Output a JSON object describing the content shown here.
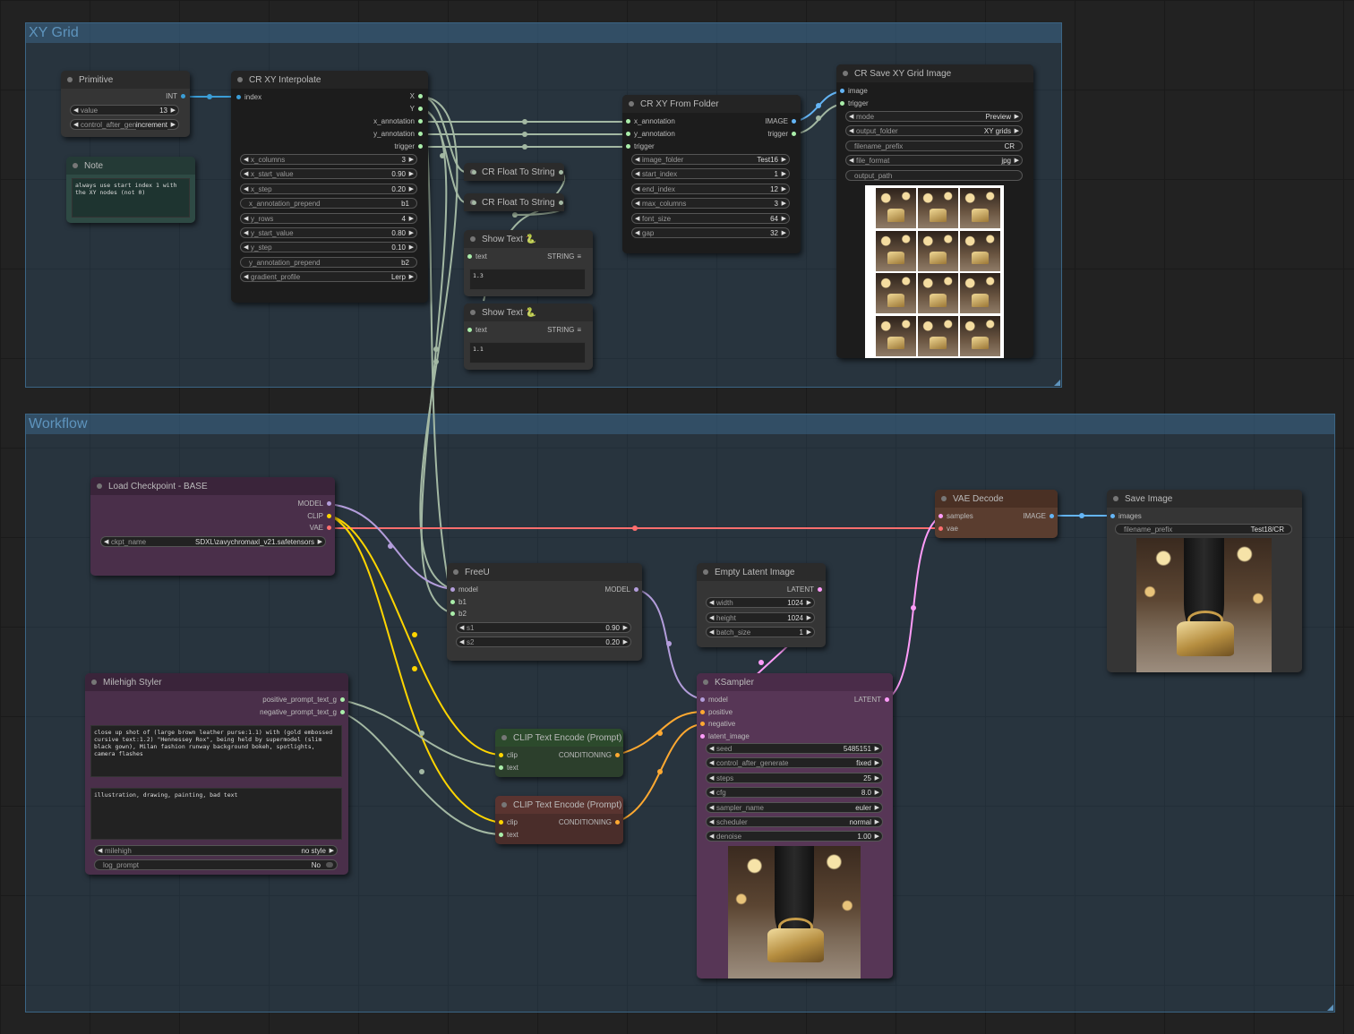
{
  "groups": {
    "xy_grid": "XY Grid",
    "workflow": "Workflow"
  },
  "primitive": {
    "title": "Primitive",
    "output": "INT",
    "value_label": "value",
    "value": "13",
    "control_label": "control_after_generate",
    "control": "increment"
  },
  "note": {
    "title": "Note",
    "text": "always use start index 1 with the XY nodes (not 0)"
  },
  "interp": {
    "title": "CR XY Interpolate",
    "input": "index",
    "outputs": [
      "X",
      "Y",
      "x_annotation",
      "y_annotation",
      "trigger"
    ],
    "widgets": [
      {
        "label": "x_columns",
        "value": "3",
        "arrows": true
      },
      {
        "label": "x_start_value",
        "value": "0.90",
        "arrows": true
      },
      {
        "label": "x_step",
        "value": "0.20",
        "arrows": true
      },
      {
        "label": "x_annotation_prepend",
        "value": "b1",
        "arrows": false
      },
      {
        "label": "y_rows",
        "value": "4",
        "arrows": true
      },
      {
        "label": "y_start_value",
        "value": "0.80",
        "arrows": true
      },
      {
        "label": "y_step",
        "value": "0.10",
        "arrows": true
      },
      {
        "label": "y_annotation_prepend",
        "value": "b2",
        "arrows": false
      },
      {
        "label": "gradient_profile",
        "value": "Lerp",
        "arrows": true
      }
    ]
  },
  "float1": {
    "title": "CR Float To String"
  },
  "float2": {
    "title": "CR Float To String"
  },
  "show1": {
    "title": "Show Text 🐍",
    "input": "text",
    "output": "STRING",
    "value": "1.3"
  },
  "show2": {
    "title": "Show Text 🐍",
    "input": "text",
    "output": "STRING",
    "value": "1.1"
  },
  "folder": {
    "title": "CR XY From Folder",
    "inputs": [
      "x_annotation",
      "y_annotation",
      "trigger"
    ],
    "outputs": [
      "IMAGE",
      "trigger"
    ],
    "widgets": [
      {
        "label": "image_folder",
        "value": "Test16"
      },
      {
        "label": "start_index",
        "value": "1"
      },
      {
        "label": "end_index",
        "value": "12"
      },
      {
        "label": "max_columns",
        "value": "3"
      },
      {
        "label": "font_size",
        "value": "64"
      },
      {
        "label": "gap",
        "value": "32"
      }
    ]
  },
  "savexy": {
    "title": "CR Save XY Grid Image",
    "inputs": [
      "image",
      "trigger"
    ],
    "widgets": [
      {
        "label": "mode",
        "value": "Preview",
        "arrows": true
      },
      {
        "label": "output_folder",
        "value": "XY grids",
        "arrows": true
      },
      {
        "label": "filename_prefix",
        "value": "CR",
        "arrows": false
      },
      {
        "label": "file_format",
        "value": "jpg",
        "arrows": true
      },
      {
        "label": "output_path",
        "value": "",
        "arrows": false
      }
    ]
  },
  "ckpt": {
    "title": "Load Checkpoint - BASE",
    "outputs": [
      "MODEL",
      "CLIP",
      "VAE"
    ],
    "widget_label": "ckpt_name",
    "widget_value": "SDXL\\zavychromaxl_v21.safetensors"
  },
  "freeu": {
    "title": "FreeU",
    "inputs": [
      "model",
      "b1",
      "b2"
    ],
    "output": "MODEL",
    "widgets": [
      {
        "label": "s1",
        "value": "0.90"
      },
      {
        "label": "s2",
        "value": "0.20"
      }
    ]
  },
  "latent": {
    "title": "Empty Latent Image",
    "output": "LATENT",
    "widgets": [
      {
        "label": "width",
        "value": "1024"
      },
      {
        "label": "height",
        "value": "1024"
      },
      {
        "label": "batch_size",
        "value": "1"
      }
    ]
  },
  "vae": {
    "title": "VAE Decode",
    "inputs": [
      "samples",
      "vae"
    ],
    "output": "IMAGE"
  },
  "save": {
    "title": "Save Image",
    "input": "images",
    "widget_label": "filename_prefix",
    "widget_value": "Test18/CR"
  },
  "styler": {
    "title": "Milehigh Styler",
    "outputs": [
      "positive_prompt_text_g",
      "negative_prompt_text_g"
    ],
    "positive": "close up shot of (large brown leather purse:1.1) with (gold embossed cursive text:1.2) \"Hennessey Rox\", being held by supermodel (slim black gown), Milan fashion runway background bokeh, spotlights, camera flashes",
    "negative": "illustration, drawing, painting, bad text",
    "milehigh_label": "milehigh",
    "milehigh_value": "no style",
    "log_label": "log_prompt",
    "log_value": "No"
  },
  "clip_pos": {
    "title": "CLIP Text Encode (Prompt)",
    "inputs": [
      "clip",
      "text"
    ],
    "output": "CONDITIONING"
  },
  "clip_neg": {
    "title": "CLIP Text Encode (Prompt)",
    "inputs": [
      "clip",
      "text"
    ],
    "output": "CONDITIONING"
  },
  "ksampler": {
    "title": "KSampler",
    "inputs": [
      "model",
      "positive",
      "negative",
      "latent_image"
    ],
    "output": "LATENT",
    "widgets": [
      {
        "label": "seed",
        "value": "5485151"
      },
      {
        "label": "control_after_generate",
        "value": "fixed"
      },
      {
        "label": "steps",
        "value": "25"
      },
      {
        "label": "cfg",
        "value": "8.0"
      },
      {
        "label": "sampler_name",
        "value": "euler"
      },
      {
        "label": "scheduler",
        "value": "normal"
      },
      {
        "label": "denoise",
        "value": "1.00"
      }
    ]
  },
  "colors": {
    "model": "#b39ddb",
    "clip": "#ffd500",
    "vae": "#ff6e6e",
    "conditioning": "#ffa931",
    "latent": "#ff9cf9",
    "image": "#64b5f6",
    "int": "#3b9dd6",
    "float": "#aaeeaa",
    "load_node": "#4a2f4a",
    "styler_node": "#4a2f4a",
    "clip_pos_node": "#2c3f2c",
    "clip_neg_node": "#4a2d2a",
    "vae_node": "#5a3d2f",
    "ksampler_node": "#573656"
  }
}
